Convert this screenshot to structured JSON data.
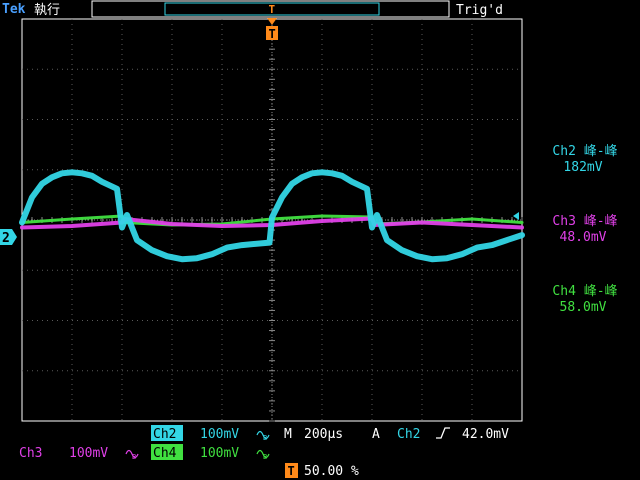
{
  "header": {
    "brand": "Tek",
    "state": "執行",
    "trigger_status": "Trig'd"
  },
  "colors": {
    "ch2": "#33d6e6",
    "ch3": "#e040e8",
    "ch4": "#40e040",
    "brand": "#4aa0ff",
    "trigger": "#ff8a1a",
    "grid": "#5a5a5a",
    "frame": "#ffffff"
  },
  "measurements": [
    {
      "label": "Ch2 峰-峰",
      "value": "182mV",
      "color": "#33d6e6"
    },
    {
      "label": "Ch3 峰-峰",
      "value": "48.0mV",
      "color": "#e040e8"
    },
    {
      "label": "Ch4 峰-峰",
      "value": "58.0mV",
      "color": "#40e040"
    }
  ],
  "footer": {
    "ch2": {
      "name": "Ch2",
      "scale": "100mV",
      "bw_icon": "bandwidth-limit-icon"
    },
    "ch3": {
      "name": "Ch3",
      "scale": "100mV",
      "bw_icon": "bandwidth-limit-icon"
    },
    "ch4": {
      "name": "Ch4",
      "scale": "100mV",
      "bw_icon": "bandwidth-limit-icon"
    },
    "timebase": {
      "prefix": "M",
      "value": "200µs"
    },
    "trigger": {
      "mode": "A",
      "source": "Ch2",
      "slope_icon": "rising-edge-icon",
      "level": "42.0mV"
    },
    "position": {
      "icon": "trigger-T-icon",
      "value": "50.00 %"
    }
  },
  "markers": {
    "trigger_top": "T",
    "ch2_ground": "2"
  },
  "chart_data": {
    "type": "line",
    "xlabel": "",
    "ylabel": "",
    "xlim": [
      -5,
      5
    ],
    "ylim": [
      -4,
      4
    ],
    "grid": true,
    "series": [
      {
        "name": "Ch2",
        "values": [
          [
            -5.0,
            -0.05
          ],
          [
            -4.8,
            0.45
          ],
          [
            -4.6,
            0.72
          ],
          [
            -4.4,
            0.85
          ],
          [
            -4.2,
            0.93
          ],
          [
            -4.0,
            0.95
          ],
          [
            -3.8,
            0.93
          ],
          [
            -3.6,
            0.88
          ],
          [
            -3.4,
            0.76
          ],
          [
            -3.1,
            0.62
          ],
          [
            -3.0,
            -0.15
          ],
          [
            -2.9,
            0.1
          ],
          [
            -2.7,
            -0.4
          ],
          [
            -2.4,
            -0.6
          ],
          [
            -2.1,
            -0.72
          ],
          [
            -1.8,
            -0.78
          ],
          [
            -1.5,
            -0.76
          ],
          [
            -1.2,
            -0.68
          ],
          [
            -0.9,
            -0.55
          ],
          [
            -0.6,
            -0.5
          ],
          [
            -0.05,
            -0.45
          ],
          [
            0.0,
            0.05
          ],
          [
            0.2,
            0.45
          ],
          [
            0.4,
            0.72
          ],
          [
            0.6,
            0.85
          ],
          [
            0.8,
            0.93
          ],
          [
            1.0,
            0.95
          ],
          [
            1.2,
            0.93
          ],
          [
            1.4,
            0.88
          ],
          [
            1.6,
            0.76
          ],
          [
            1.9,
            0.62
          ],
          [
            2.0,
            -0.15
          ],
          [
            2.1,
            0.1
          ],
          [
            2.3,
            -0.4
          ],
          [
            2.6,
            -0.6
          ],
          [
            2.9,
            -0.72
          ],
          [
            3.2,
            -0.78
          ],
          [
            3.5,
            -0.76
          ],
          [
            3.8,
            -0.68
          ],
          [
            4.1,
            -0.55
          ],
          [
            4.4,
            -0.5
          ],
          [
            5.0,
            -0.3
          ]
        ]
      },
      {
        "name": "Ch3",
        "values": [
          [
            -5.0,
            -0.15
          ],
          [
            -4.0,
            -0.12
          ],
          [
            -3.0,
            -0.05
          ],
          [
            -2.95,
            0.02
          ],
          [
            -2.0,
            -0.08
          ],
          [
            -1.0,
            -0.12
          ],
          [
            0.0,
            -0.1
          ],
          [
            1.0,
            -0.02
          ],
          [
            2.0,
            0.03
          ],
          [
            2.05,
            -0.1
          ],
          [
            3.0,
            -0.05
          ],
          [
            4.0,
            -0.1
          ],
          [
            5.0,
            -0.15
          ]
        ]
      },
      {
        "name": "Ch4",
        "values": [
          [
            -5.0,
            -0.05
          ],
          [
            -4.0,
            0.02
          ],
          [
            -3.0,
            0.08
          ],
          [
            -2.95,
            -0.05
          ],
          [
            -2.0,
            -0.1
          ],
          [
            -1.0,
            -0.08
          ],
          [
            0.0,
            0.02
          ],
          [
            1.0,
            0.08
          ],
          [
            2.0,
            0.06
          ],
          [
            2.05,
            -0.08
          ],
          [
            3.0,
            -0.04
          ],
          [
            4.0,
            0.02
          ],
          [
            5.0,
            -0.05
          ]
        ]
      }
    ]
  }
}
